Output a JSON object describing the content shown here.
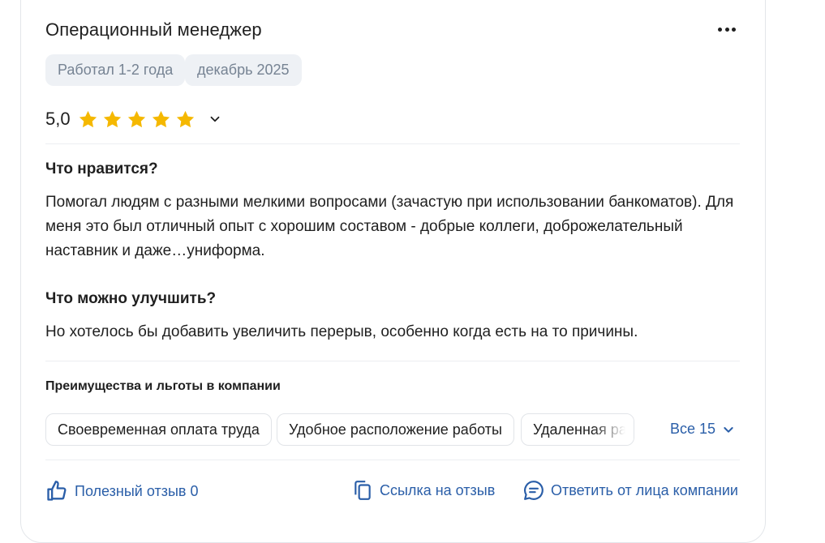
{
  "review": {
    "title": "Операционный менеджер",
    "tags": [
      "Работал 1-2 года",
      "декабрь 2025"
    ],
    "rating_value": "5,0",
    "stars": 5,
    "likes_heading": "Что нравится?",
    "likes_text": "Помогал людям с разными мелкими вопросами (зачастую при использовании банкоматов). Для меня это был отличный опыт с хорошим составом - добрые коллеги, доброжелательный наставник и даже…униформа.",
    "improve_heading": "Что можно улучшить?",
    "improve_text": "Но хотелось бы добавить увеличить перерыв, особенно когда есть на то причины.",
    "benefits_heading": "Преимущества и льготы в компании",
    "benefits": [
      "Своевременная оплата труда",
      "Удобное расположение работы",
      "Удаленная работа"
    ],
    "all_benefits_label": "Все 15"
  },
  "actions": {
    "helpful": "Полезный отзыв 0",
    "link": "Ссылка на отзыв",
    "reply": "Ответить от лица компании"
  },
  "colors": {
    "star": "#f5b800",
    "link": "#2a5ea8",
    "tag_bg": "#eef1f5",
    "tag_text": "#768393"
  },
  "icons": {
    "more": "more-dots-icon",
    "chevron": "chevron-down-icon",
    "helpful": "thumbs-up-icon",
    "link": "copy-link-icon",
    "reply": "chat-bubble-icon"
  }
}
